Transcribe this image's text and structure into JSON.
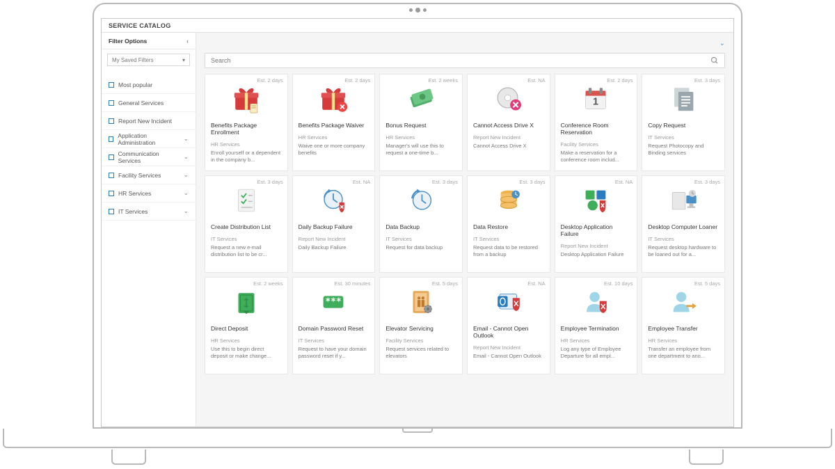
{
  "app_title": "SERVICE CATALOG",
  "sidebar": {
    "header": "Filter Options",
    "saved_filters_label": "My Saved Filters",
    "items": [
      {
        "label": "Most popular",
        "expandable": false
      },
      {
        "label": "General Services",
        "expandable": false
      },
      {
        "label": "Report New Incident",
        "expandable": false
      },
      {
        "label": "Application Administration",
        "expandable": true
      },
      {
        "label": "Communication Services",
        "expandable": true
      },
      {
        "label": "Facility Services",
        "expandable": true
      },
      {
        "label": "HR Services",
        "expandable": true
      },
      {
        "label": "IT Services",
        "expandable": true
      }
    ]
  },
  "search": {
    "placeholder": "Search"
  },
  "cards": [
    {
      "est": "Est. 2 days",
      "title": "Benefits Package Enrollment",
      "category": "HR Services",
      "desc": "Enroll yourself or a dependent in the company b...",
      "icon": "gift"
    },
    {
      "est": "Est. 2 days",
      "title": "Benefits Package Waiver",
      "category": "HR Services",
      "desc": "Waive one or more company benefits",
      "icon": "gift-x"
    },
    {
      "est": "Est. 2 weeks",
      "title": "Bonus Request",
      "category": "HR Services",
      "desc": "Manager's will use this to request a one-time b...",
      "icon": "cash"
    },
    {
      "est": "Est. NA",
      "title": "Cannot Access Drive X",
      "category": "Report New Incident",
      "desc": "Cannot Access Drive X",
      "icon": "disc-x"
    },
    {
      "est": "Est. 2 days",
      "title": "Conference Room Reservation",
      "category": "Facility Services",
      "desc": "Make a reservation for a conference room includ...",
      "icon": "calendar"
    },
    {
      "est": "Est. 3 days",
      "title": "Copy Request",
      "category": "IT Services",
      "desc": "Request Photocopy and Binding services",
      "icon": "doc"
    },
    {
      "est": "Est. 3 days",
      "title": "Create Distribution List",
      "category": "IT Services",
      "desc": "Request a new e-mail distribution list to be cr...",
      "icon": "checklist"
    },
    {
      "est": "Est. NA",
      "title": "Daily Backup Failure",
      "category": "Report New Incident",
      "desc": "Daily Backup Failure",
      "icon": "clock-shield"
    },
    {
      "est": "Est. 3 days",
      "title": "Data Backup",
      "category": "IT Services",
      "desc": "Request for data backup",
      "icon": "clock"
    },
    {
      "est": "Est. 3 days",
      "title": "Data Restore",
      "category": "IT Services",
      "desc": "Request data to be restored from a backup",
      "icon": "database"
    },
    {
      "est": "Est. NA",
      "title": "Desktop Application Failure",
      "category": "Report New Incident",
      "desc": "Desktop Application Failure",
      "icon": "apps-shield"
    },
    {
      "est": "Est. 3 days",
      "title": "Desktop Computer Loaner",
      "category": "IT Services",
      "desc": "Request desktop hardware to be loaned out for a...",
      "icon": "computer"
    },
    {
      "est": "Est. 2 weeks",
      "title": "Direct Deposit",
      "category": "HR Services",
      "desc": "Use this to begin direct deposit or make change...",
      "icon": "money"
    },
    {
      "est": "Est. 30 minutes",
      "title": "Domain Password Reset",
      "category": "IT Services",
      "desc": "Request to have your domain password reset if y...",
      "icon": "password"
    },
    {
      "est": "Est. 5 days",
      "title": "Elevator Servicing",
      "category": "Facility Services",
      "desc": "Request services related to elevators",
      "icon": "elevator"
    },
    {
      "est": "Est. NA",
      "title": "Email - Cannot Open Outlook",
      "category": "Report New Incident",
      "desc": "Email - Cannot Open Outlook",
      "icon": "outlook-shield"
    },
    {
      "est": "Est. 10 days",
      "title": "Employee Termination",
      "category": "HR Services",
      "desc": "Log any type of Employee Departure for all empl...",
      "icon": "person-shield"
    },
    {
      "est": "Est. 5 days",
      "title": "Employee Transfer",
      "category": "HR Services",
      "desc": "Transfer an employee from one department to ano...",
      "icon": "person-arrow"
    }
  ]
}
